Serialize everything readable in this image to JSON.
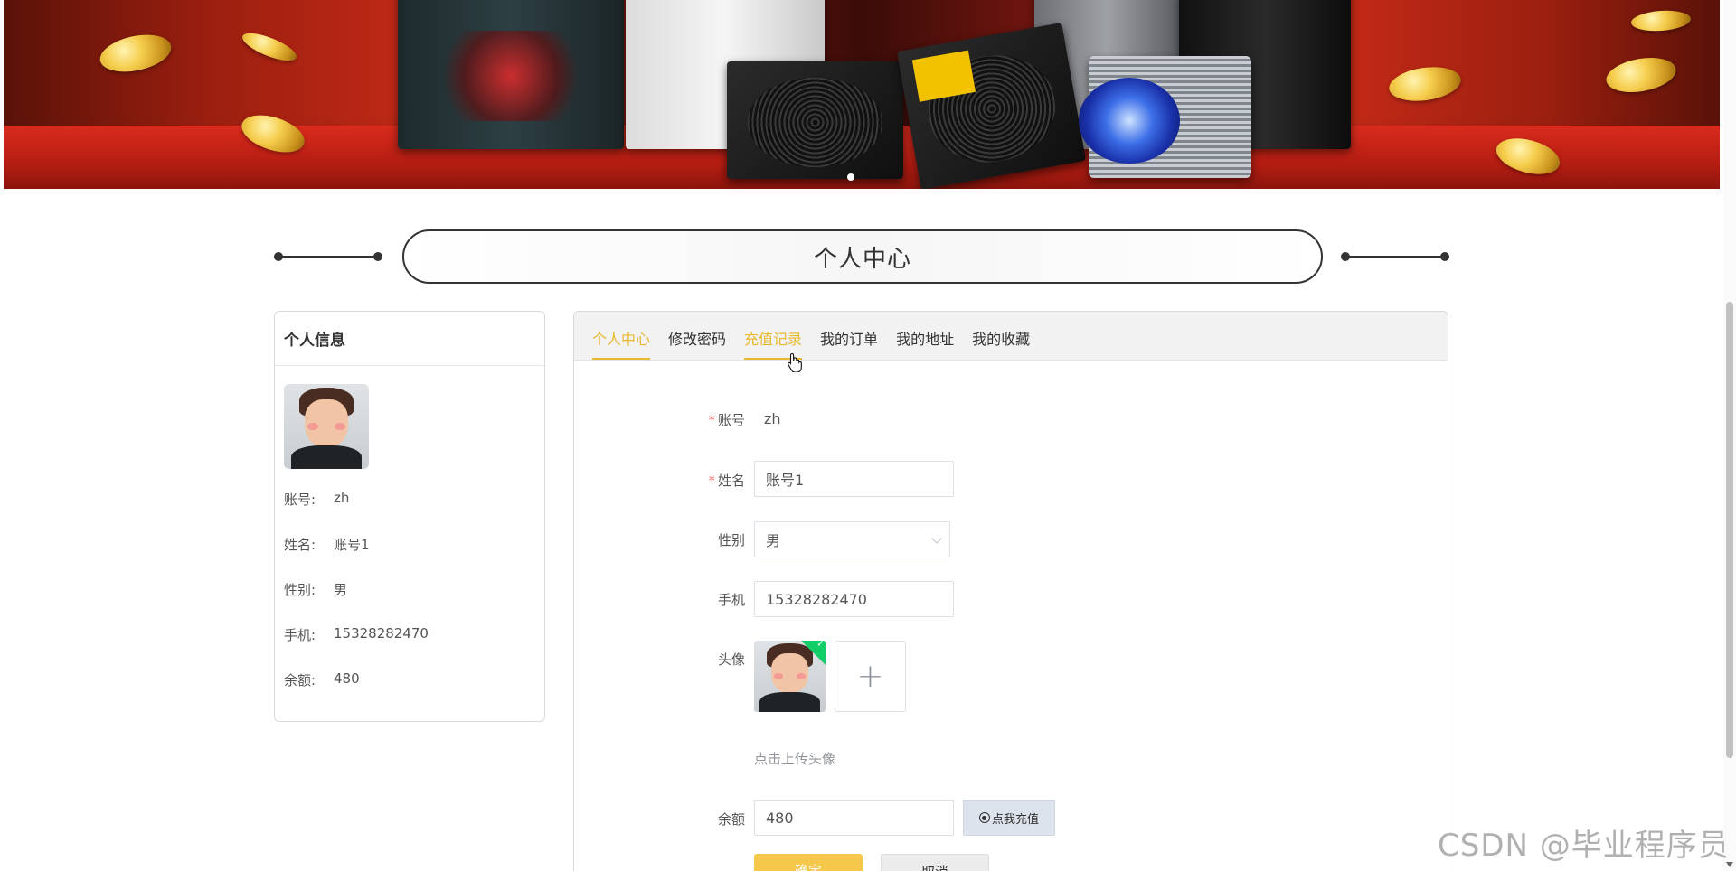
{
  "page_title": "个人中心",
  "info_card": {
    "heading": "个人信息",
    "rows": [
      {
        "label": "账号:",
        "value": "zh"
      },
      {
        "label": "姓名:",
        "value": "账号1"
      },
      {
        "label": "性别:",
        "value": "男"
      },
      {
        "label": "手机:",
        "value": "15328282470"
      },
      {
        "label": "余额:",
        "value": "480"
      }
    ]
  },
  "tabs": [
    {
      "label": "个人中心",
      "state": "active"
    },
    {
      "label": "修改密码",
      "state": "normal"
    },
    {
      "label": "充值记录",
      "state": "hover"
    },
    {
      "label": "我的订单",
      "state": "normal"
    },
    {
      "label": "我的地址",
      "state": "normal"
    },
    {
      "label": "我的收藏",
      "state": "normal"
    }
  ],
  "form": {
    "account": {
      "label": "账号",
      "value": "zh",
      "required": true
    },
    "name": {
      "label": "姓名",
      "value": "账号1",
      "required": true
    },
    "gender": {
      "label": "性别",
      "value": "男"
    },
    "phone": {
      "label": "手机",
      "value": "15328282470"
    },
    "avatar": {
      "label": "头像",
      "hint": "点击上传头像"
    },
    "balance": {
      "label": "余额",
      "value": "480",
      "recharge_label": "点我充值"
    },
    "confirm_label": "确定",
    "cancel_label": "取消",
    "required_mark": "*"
  },
  "watermark": "CSDN @毕业程序员",
  "colors": {
    "accent": "#e9b82f",
    "confirm_button": "#f5c84b",
    "required": "#f56c6c",
    "success_badge": "#13ce66"
  },
  "icons": {
    "upload": "plus-icon",
    "recharge": "radio-icon",
    "select": "chevron-down-icon",
    "uploaded_ok": "check-icon"
  }
}
